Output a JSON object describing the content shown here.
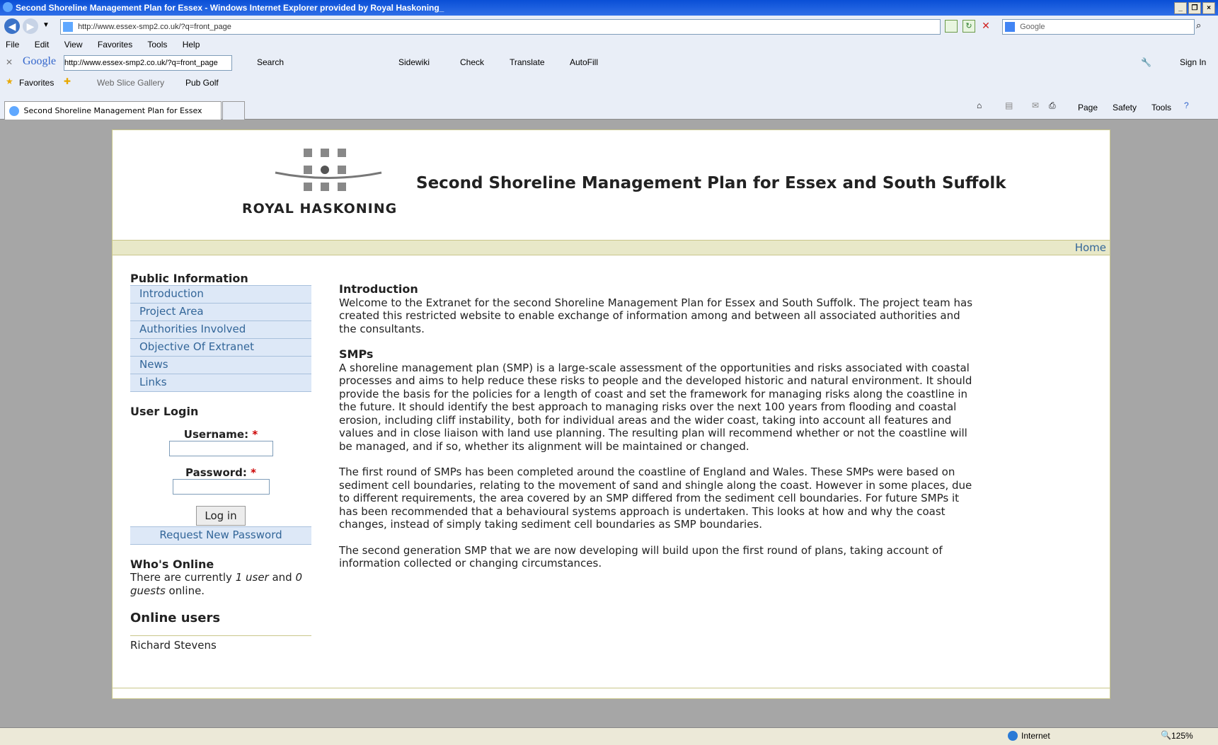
{
  "window": {
    "title": "Second Shoreline Management Plan for Essex - Windows Internet Explorer provided by Royal Haskoning_",
    "url": "http://www.essex-smp2.co.uk/?q=front_page",
    "search_placeholder": "Google"
  },
  "menubar": [
    "File",
    "Edit",
    "View",
    "Favorites",
    "Tools",
    "Help"
  ],
  "google_toolbar": {
    "brand": "Google",
    "url_field": "http://www.essex-smp2.co.uk/?q=front_page",
    "search": "Search",
    "sidewiki": "Sidewiki",
    "check": "Check",
    "translate": "Translate",
    "autofill": "AutoFill",
    "signin": "Sign In"
  },
  "favorites_bar": {
    "favorites": "Favorites",
    "web_slice": "Web Slice Gallery",
    "pub_golf": "Pub Golf"
  },
  "tab": {
    "label": "Second Shoreline Management Plan for Essex"
  },
  "command_bar": {
    "page": "Page",
    "safety": "Safety",
    "tools": "Tools"
  },
  "site": {
    "logo_text": "ROYAL HASKONING",
    "title": "Second Shoreline Management Plan for Essex and South Suffolk",
    "home_link": "Home"
  },
  "sidebar": {
    "public_info_title": "Public Information",
    "items": [
      "Introduction",
      "Project Area",
      "Authorities Involved",
      "Objective Of Extranet",
      "News",
      "Links"
    ],
    "user_login_title": "User Login",
    "username_label": "Username:",
    "password_label": "Password:",
    "required_mark": "*",
    "login_button": "Log in",
    "request_password": "Request New Password",
    "whos_online_title": "Who's Online",
    "whos_online_text_1": "There are currently ",
    "whos_online_user": "1 user",
    "whos_online_text_2": " and ",
    "whos_online_guests": "0 guests",
    "whos_online_text_3": " online.",
    "online_users_title": "Online users",
    "online_user": "Richard Stevens"
  },
  "content": {
    "intro_heading": "Introduction",
    "intro_text": "Welcome to the Extranet for the second Shoreline Management Plan for Essex and South Suffolk. The project team has created this restricted website to enable exchange of information among and between all associated authorities and the consultants.",
    "smps_heading": "SMPs",
    "smps_p1": "A shoreline management plan (SMP) is a large-scale assessment of the opportunities and risks associated with coastal processes and aims to help reduce these risks to people and the developed historic and natural environment. It should provide the basis for the policies for a length of coast and set the framework for managing risks along the coastline in the future. It should identify the best approach to managing risks over the next 100 years from flooding and coastal erosion, including cliff instability, both for individual areas and the wider coast, taking into account all features and values and in close liaison with land use planning. The resulting plan will recommend whether or not the coastline will be managed, and if so, whether its alignment will be maintained or changed.",
    "smps_p2": "The first round of SMPs has been completed around the coastline of England and Wales. These SMPs were based on sediment cell boundaries, relating to the movement of sand and shingle along the coast. However in some places, due to different requirements, the area covered by an SMP differed from the sediment cell boundaries. For future SMPs it has been recommended that a behavioural systems approach is undertaken. This looks at how and why the coast changes, instead of simply taking sediment cell boundaries as SMP boundaries.",
    "smps_p3": "The second generation SMP that we are now developing will build upon the first round of plans, taking account of information collected or changing circumstances."
  },
  "status_bar": {
    "zone": "Internet",
    "zoom": "125%"
  }
}
